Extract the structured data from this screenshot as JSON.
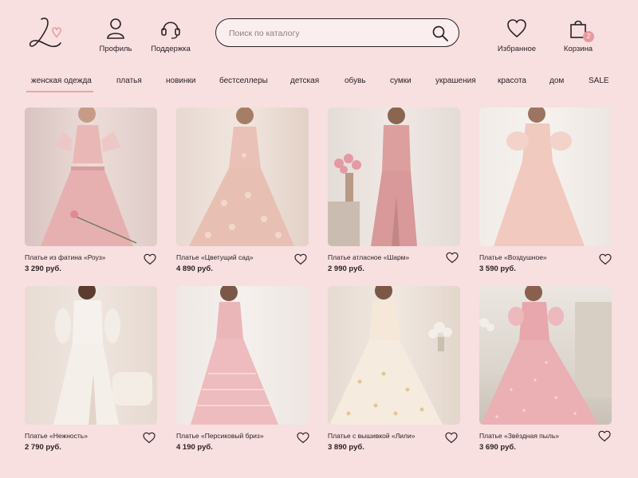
{
  "header": {
    "logo_letter": "L",
    "profile_label": "Профиль",
    "support_label": "Поддержка",
    "search_placeholder": "Поиск по каталогу",
    "favorites_label": "Избранное",
    "cart_label": "Корзина",
    "cart_count": "2"
  },
  "nav": {
    "items": [
      "женская одежда",
      "платья",
      "новинки",
      "бестселлеры",
      "детская",
      "обувь",
      "сумки",
      "украшения",
      "красота",
      "дом",
      "SALE"
    ],
    "active_index": 0
  },
  "colors": {
    "background": "#f8dfe0",
    "accent": "#e8999f",
    "text": "#2a2226"
  },
  "products": [
    {
      "title": "Платье из фатина «Роуз»",
      "price": "3 290 руб."
    },
    {
      "title": "Платье «Цветущий сад»",
      "price": "4 890 руб."
    },
    {
      "title": "Платье атласное «Шарм»",
      "price": "2 990 руб."
    },
    {
      "title": "Платье «Воздушное»",
      "price": "3 590 руб."
    },
    {
      "title": "Платье «Нежность»",
      "price": "2 790 руб."
    },
    {
      "title": "Платье «Персиковый бриз»",
      "price": "4 190 руб."
    },
    {
      "title": "Платье с вышивкой «Лили»",
      "price": "3 890 руб."
    },
    {
      "title": "Платье «Звёздная пыль»",
      "price": "3 690 руб."
    }
  ]
}
